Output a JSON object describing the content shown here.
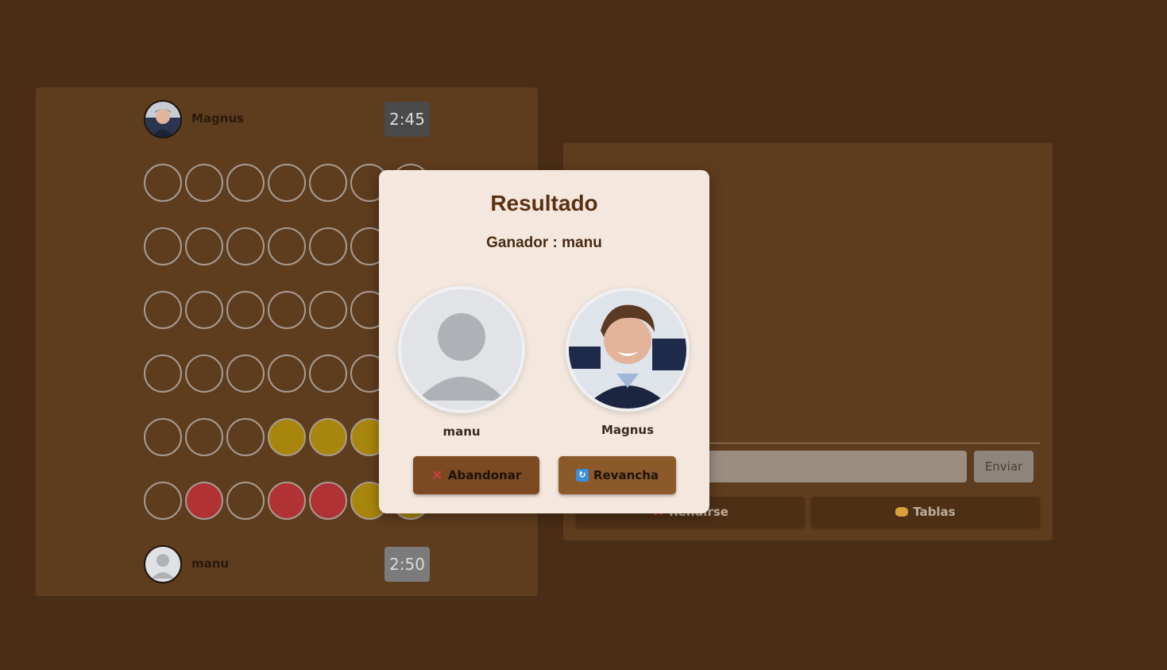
{
  "game": {
    "top_player": {
      "name": "Magnus",
      "clock": "2:45"
    },
    "bottom_player": {
      "name": "manu",
      "clock": "2:50"
    },
    "board": {
      "rows": [
        [
          "empty",
          "empty",
          "empty",
          "empty",
          "empty",
          "empty",
          "empty"
        ],
        [
          "empty",
          "empty",
          "empty",
          "empty",
          "empty",
          "empty",
          "empty"
        ],
        [
          "empty",
          "empty",
          "empty",
          "empty",
          "empty",
          "empty",
          "empty"
        ],
        [
          "empty",
          "empty",
          "empty",
          "empty",
          "empty",
          "empty",
          "empty"
        ],
        [
          "empty",
          "empty",
          "empty",
          "yellow",
          "yellow",
          "yellow",
          "empty"
        ],
        [
          "empty",
          "red",
          "empty",
          "red",
          "red",
          "yellow",
          "yellow"
        ]
      ]
    }
  },
  "chat": {
    "input_placeholder": "",
    "send_label": "Enviar",
    "resign_label": "Rendirse",
    "draw_label": "Tablas"
  },
  "modal": {
    "title": "Resultado",
    "winner_line": "Ganador : manu",
    "left_player": "manu",
    "right_player": "Magnus",
    "abandon_label": "Abandonar",
    "rematch_label": "Revancha"
  },
  "colors": {
    "background": "#4a2d16",
    "panel": "#5e3c1e",
    "red_piece": "#b03234",
    "yellow_piece": "#a8860d",
    "modal": "#f4e8de"
  }
}
